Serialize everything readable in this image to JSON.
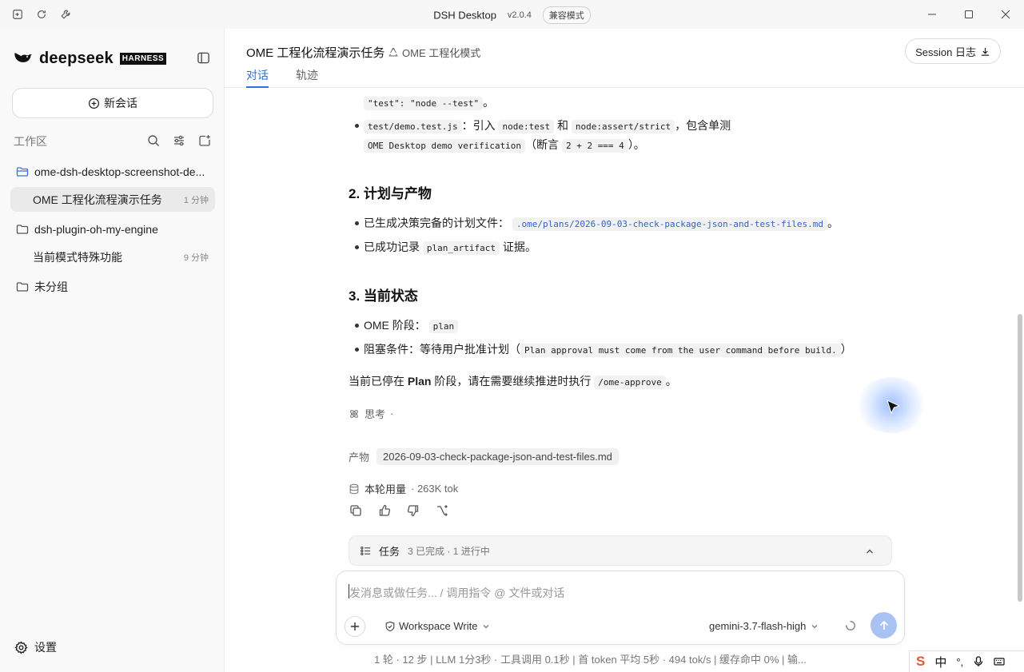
{
  "window": {
    "title": "DSH Desktop",
    "version": "v2.0.4",
    "compat_badge": "兼容模式"
  },
  "sidebar": {
    "brand": "deepseek",
    "brand_badge": "HARNESS",
    "new_chat_label": "新会话",
    "workspace_title": "工作区",
    "tree": [
      {
        "folder": "ome-dsh-desktop-screenshot-de...",
        "open": true
      },
      {
        "chat": "OME 工程化流程演示任务",
        "time": "1 分钟"
      },
      {
        "folder": "dsh-plugin-oh-my-engine",
        "open": false
      },
      {
        "chat": "当前模式特殊功能",
        "time": "9 分钟"
      },
      {
        "folder": "未分组",
        "open": false
      }
    ],
    "settings_label": "设置"
  },
  "header": {
    "conversation_title": "OME 工程化流程演示任务",
    "mode_label": "OME 工程化模式",
    "session_log_label": "Session 日志",
    "tabs": [
      {
        "label": "对话",
        "active": true
      },
      {
        "label": "轨迹",
        "active": false
      }
    ]
  },
  "message": {
    "top_code": "\"test\": \"node --test\"",
    "top_code_suffix": "。",
    "bullet_demo": {
      "file": "test/demo.test.js",
      "text1": "：引入",
      "code1": "node:test",
      "text2": "和",
      "code2": "node:assert/strict",
      "text3": "，包含单测",
      "code3": "OME Desktop demo verification",
      "text4": "（断言",
      "code4": "2 + 2 === 4",
      "text5": "）。"
    },
    "section2_title": "2. 计划与产物",
    "section2_items": [
      {
        "text": "已生成决策完备的计划文件：",
        "code": ".ome/plans/2026-09-03-check-package-json-and-test-files.md",
        "suffix": "。"
      },
      {
        "text": "已成功记录",
        "code": "plan_artifact",
        "suffix": "证据。"
      }
    ],
    "section3_title": "3. 当前状态",
    "section3_items": [
      {
        "text": "OME 阶段：",
        "code": "plan",
        "suffix": ""
      },
      {
        "text": "阻塞条件：等待用户批准计划（",
        "code": "Plan approval must come from the user command before build.",
        "suffix": "）"
      }
    ],
    "closing": {
      "pre": "当前已停在",
      "bold": "Plan",
      "mid": "阶段，请在需要继续推进时执行",
      "code": "/ome-approve",
      "post": "。"
    },
    "thinking_label": "思考",
    "thinking_sep": "·",
    "artifact_label": "产物",
    "artifact_file": "2026-09-03-check-package-json-and-test-files.md",
    "usage_label": "本轮用量",
    "usage_value": "· 263K tok"
  },
  "tasks": {
    "label": "任务",
    "status": "3 已完成 · 1 进行中"
  },
  "composer": {
    "placeholder": "发消息或做任务... / 调用指令 @ 文件或对话",
    "permission": "Workspace Write",
    "model": "gemini-3.7-flash-high"
  },
  "footer_stats": "1 轮 · 12 步   |   LLM 1分3秒 · 工具调用 0.1秒   |   首 token 平均 5秒 · 494 tok/s   |   缓存命中 0%   |   输...",
  "ime": {
    "logo": "S",
    "lang": "中",
    "punct": "°,"
  },
  "colors": {
    "accent": "#2f6fde",
    "send_disabled": "#a8c3f3",
    "sidebar_bg": "#f9f9f9",
    "active_item_bg": "#eaeaea"
  }
}
